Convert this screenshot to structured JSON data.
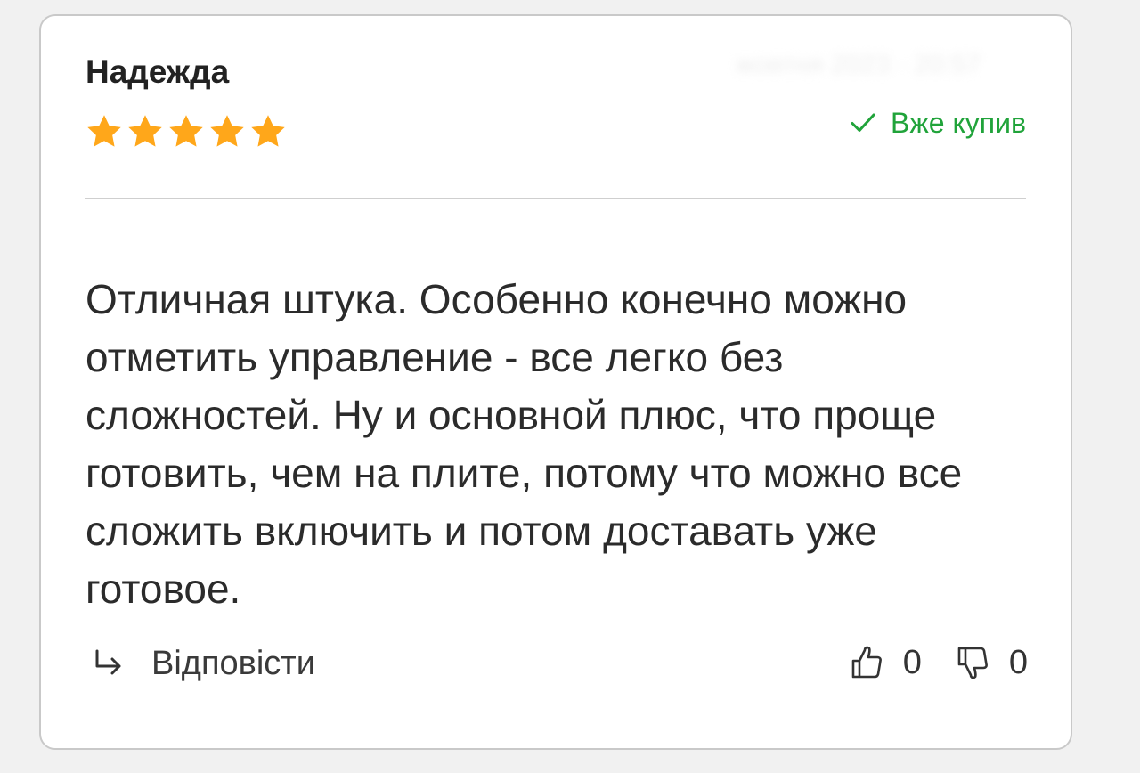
{
  "review": {
    "author": "Надежда",
    "date": "жовтня 2023 · 20:57",
    "rating": {
      "value": 5,
      "max": 5
    },
    "bought_label": "Вже купив",
    "text": "Отличная штука. Особенно конечно можно отметить управление - все легко без сложностей. Ну и основной плюс, что проще готовить, чем на плите, потому что можно все сложить включить и потом доставать уже готовое.",
    "reply_label": "Відповісти",
    "likes": "0",
    "dislikes": "0"
  },
  "colors": {
    "star": "#ffa71a",
    "bought": "#20a33a",
    "text": "#2b2b2b",
    "border": "#c9c9c9"
  },
  "icons": {
    "rating": "star-icon",
    "bought": "check-icon",
    "reply": "reply-arrow-icon",
    "like": "thumbs-up-icon",
    "dislike": "thumbs-down-icon"
  }
}
